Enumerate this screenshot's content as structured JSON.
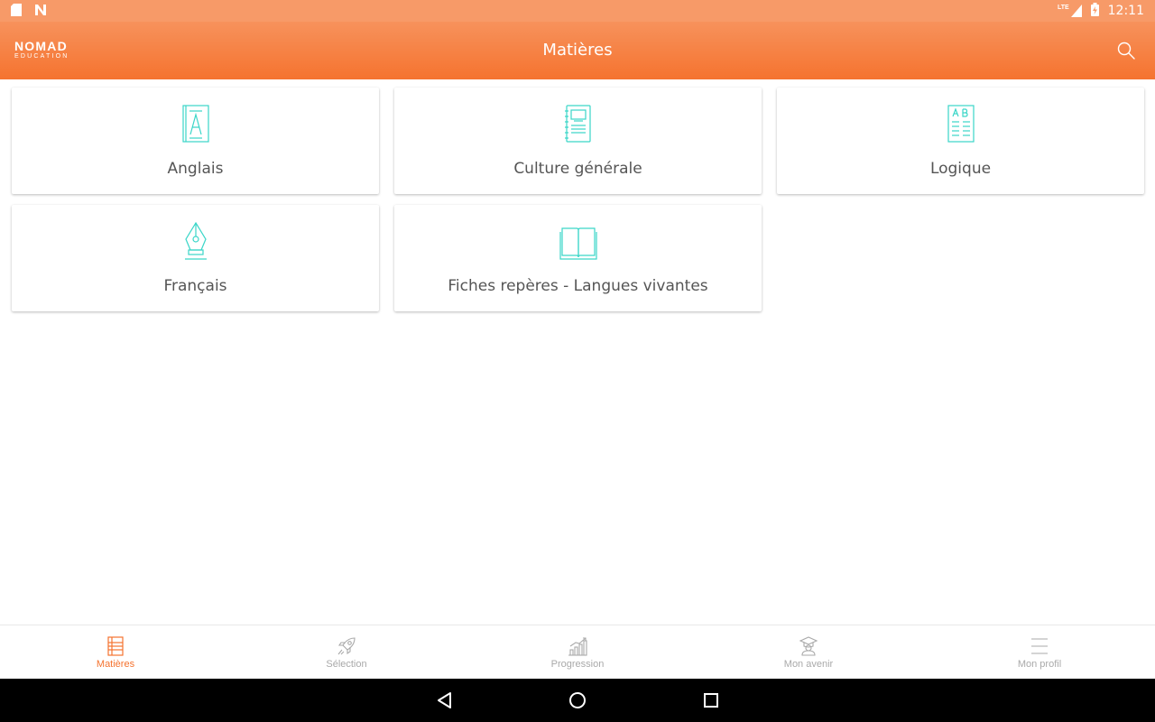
{
  "status_bar": {
    "network_label": "LTE",
    "time": "12:11"
  },
  "app_bar": {
    "logo_line1": "NOMAD",
    "logo_line2": "EDUCATION",
    "title": "Matières",
    "search_icon": "search-icon"
  },
  "subjects": [
    {
      "label": "Anglais",
      "icon": "book-letter-icon"
    },
    {
      "label": "Culture générale",
      "icon": "notebook-icon"
    },
    {
      "label": "Logique",
      "icon": "ab-sheet-icon"
    },
    {
      "label": "Français",
      "icon": "fountain-pen-icon"
    },
    {
      "label": "Fiches repères - Langues vivantes",
      "icon": "open-book-icon"
    }
  ],
  "bottom_nav": [
    {
      "label": "Matières",
      "icon": "books-icon",
      "active": true
    },
    {
      "label": "Sélection",
      "icon": "rocket-icon",
      "active": false
    },
    {
      "label": "Progression",
      "icon": "chart-icon",
      "active": false
    },
    {
      "label": "Mon avenir",
      "icon": "graduate-icon",
      "active": false
    },
    {
      "label": "Mon profil",
      "icon": "menu-icon",
      "active": false
    }
  ],
  "colors": {
    "accent": "#f5732f",
    "icon_teal": "#3ad6c8",
    "inactive": "#a9a9a9"
  }
}
